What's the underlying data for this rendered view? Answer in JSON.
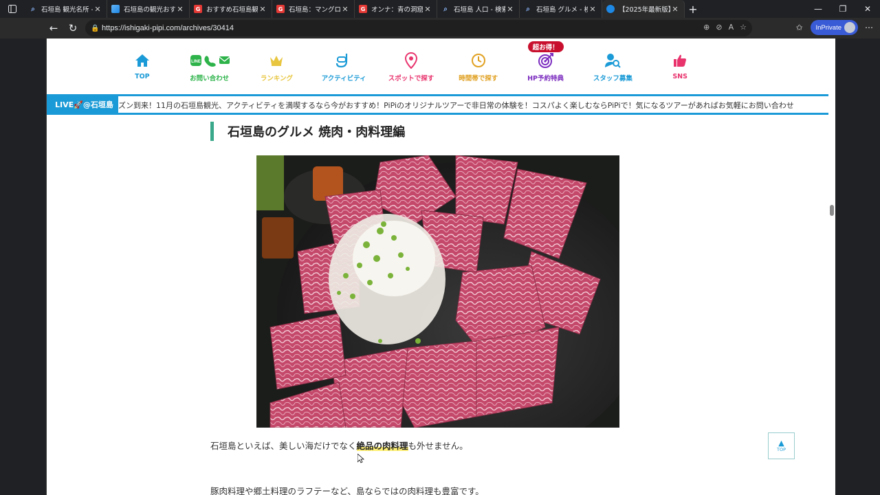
{
  "browser": {
    "tabs": [
      {
        "title": "石垣島 観光名所 -",
        "favicon": "search"
      },
      {
        "title": "石垣島の観光おすす",
        "favicon": "img"
      },
      {
        "title": "おすすめ石垣島観光",
        "favicon": "red"
      },
      {
        "title": "石垣島：マングロー",
        "favicon": "red"
      },
      {
        "title": "オンナ：青の洞窟で",
        "favicon": "red"
      },
      {
        "title": "石垣島 人口 - 検索",
        "favicon": "search"
      },
      {
        "title": "石垣島 グルメ - 検索",
        "favicon": "search"
      },
      {
        "title": "【2025年最新版】石",
        "favicon": "blue",
        "active": true
      }
    ],
    "url": "https://ishigaki-pipi.com/archives/30414",
    "inprivate_label": "InPrivate"
  },
  "site_nav": {
    "items": [
      {
        "label": "TOP",
        "color": "#1a9ad6",
        "icon": "home-icon"
      },
      {
        "label": "お問い合わせ",
        "color": "#2db34a",
        "icon": "contact-icon"
      },
      {
        "label": "ランキング",
        "color": "#e8c640",
        "icon": "crown-icon"
      },
      {
        "label": "アクティビティ",
        "color": "#1a9ad6",
        "icon": "snorkel-icon"
      },
      {
        "label": "スポットで探す",
        "color": "#e8336d",
        "icon": "pin-icon"
      },
      {
        "label": "時間帯で探す",
        "color": "#e0a020",
        "icon": "clock-icon"
      },
      {
        "label": "HP予約特典",
        "color": "#7b2cbf",
        "icon": "target-icon"
      },
      {
        "label": "スタッフ募集",
        "color": "#1a9ad6",
        "icon": "staff-icon"
      },
      {
        "label": "SNS",
        "color": "#e8336d",
        "icon": "thumbs-up-icon"
      }
    ],
    "badge": "超お得！"
  },
  "ticker": {
    "live_label": "LIVE🚀@石垣島",
    "text": "ズン到来！11月の石垣島観光、アクティビティを満喫するなら今がおすすめ！PiPiのオリジナルツアーで非日常の体験を！コスパよく楽しむならPiPiで！気になるツアーがあればお気軽にお問い合わせ"
  },
  "article": {
    "heading": "石垣島のグルメ 焼肉・肉料理編",
    "para1_pre": "石垣島といえば、美しい海だけでなく",
    "para1_hl": "絶品の肉料理",
    "para1_post": "も外せません。",
    "para2": "豚肉料理や郷土料理のラフテーなど、島ならではの肉料理も豊富です。"
  },
  "totop_label": "TOP"
}
